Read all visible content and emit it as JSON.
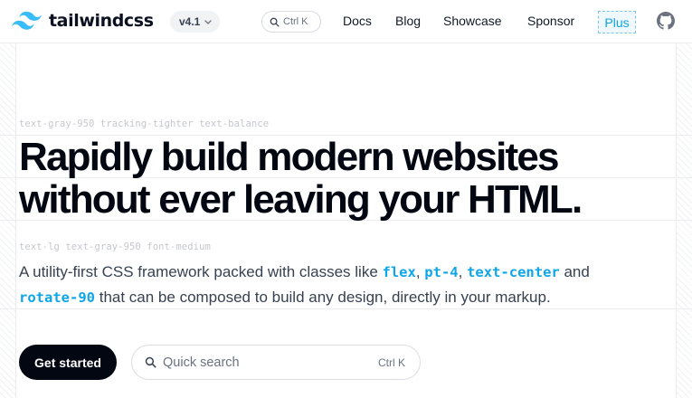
{
  "header": {
    "brand": "tailwindcss",
    "version": "v4.1",
    "search_shortcut": "Ctrl K",
    "nav": {
      "docs": "Docs",
      "blog": "Blog",
      "showcase": "Showcase",
      "sponsor": "Sponsor",
      "plus": "Plus"
    }
  },
  "hero": {
    "headline_label": "text-gray-950 tracking-tighter text-balance",
    "headline_line1": "Rapidly build modern websites",
    "headline_line2": "without ever leaving your HTML.",
    "subtext_label": "text-lg text-gray-950 font-medium",
    "subtext": {
      "intro": "A utility-first CSS framework packed with classes like ",
      "code1": "flex",
      "sep1": ", ",
      "code2": "pt-4",
      "sep2": ", ",
      "code3": "text-center",
      "sep3": " and",
      "code4": "rotate-90",
      "outro": " that can be composed to build any design, directly in your markup."
    },
    "cta_label": "Get started",
    "search": {
      "placeholder": "Quick search",
      "shortcut": "Ctrl K"
    }
  },
  "colors": {
    "accent": "#0ea5e9",
    "text": "#030712",
    "muted": "#6b7280"
  },
  "icons": [
    "tailwind-logo-icon",
    "chevron-down-icon",
    "search-icon",
    "github-icon"
  ]
}
